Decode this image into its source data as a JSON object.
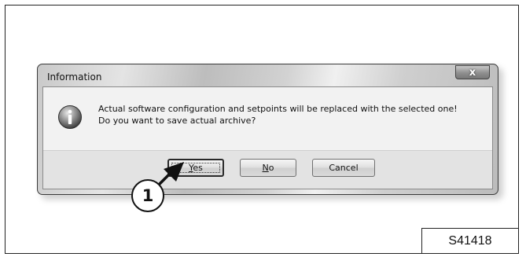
{
  "dialog": {
    "title": "Information",
    "close_glyph": "x",
    "icon": "info-icon",
    "message_line1": "Actual software configuration and setpoints will be replaced with the selected one!",
    "message_line2": "Do you want to save actual archive?",
    "buttons": {
      "yes": {
        "mnemonic": "Y",
        "rest": "es"
      },
      "no": {
        "mnemonic": "N",
        "rest": "o"
      },
      "cancel": {
        "label": "Cancel"
      }
    }
  },
  "callout": {
    "number": "1"
  },
  "figure_code": "S41418"
}
